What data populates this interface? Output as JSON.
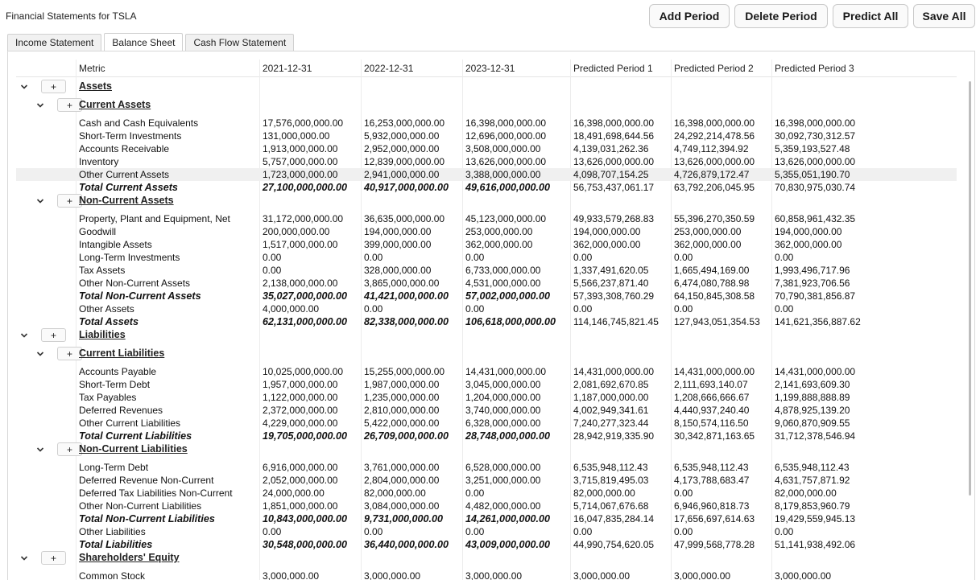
{
  "window": {
    "title": "Financial Statements for TSLA"
  },
  "toolbar": {
    "add_period": "Add Period",
    "delete_period": "Delete Period",
    "predict_all": "Predict All",
    "save_all": "Save All"
  },
  "tabs": [
    "Income Statement",
    "Balance Sheet",
    "Cash Flow Statement"
  ],
  "active_tab": "Balance Sheet",
  "columns": [
    "Metric",
    "2021-12-31",
    "2022-12-31",
    "2023-12-31",
    "Predicted Period 1",
    "Predicted Period 2",
    "Predicted Period 3"
  ],
  "plus_label": "+",
  "rows": [
    {
      "kind": "group",
      "level": 0,
      "label": "Assets"
    },
    {
      "kind": "group",
      "level": 1,
      "label": "Current Assets"
    },
    {
      "kind": "item",
      "label": "Cash and Cash Equivalents",
      "values": [
        "17,576,000,000.00",
        "16,253,000,000.00",
        "16,398,000,000.00",
        "16,398,000,000.00",
        "16,398,000,000.00",
        "16,398,000,000.00"
      ]
    },
    {
      "kind": "item",
      "label": "Short-Term Investments",
      "values": [
        "131,000,000.00",
        "5,932,000,000.00",
        "12,696,000,000.00",
        "18,491,698,644.56",
        "24,292,214,478.56",
        "30,092,730,312.57"
      ]
    },
    {
      "kind": "item",
      "label": "Accounts Receivable",
      "values": [
        "1,913,000,000.00",
        "2,952,000,000.00",
        "3,508,000,000.00",
        "4,139,031,262.36",
        "4,749,112,394.92",
        "5,359,193,527.48"
      ]
    },
    {
      "kind": "item",
      "label": "Inventory",
      "values": [
        "5,757,000,000.00",
        "12,839,000,000.00",
        "13,626,000,000.00",
        "13,626,000,000.00",
        "13,626,000,000.00",
        "13,626,000,000.00"
      ]
    },
    {
      "kind": "item",
      "label": "Other Current Assets",
      "highlight": true,
      "values": [
        "1,723,000,000.00",
        "2,941,000,000.00",
        "3,388,000,000.00",
        "4,098,707,154.25",
        "4,726,879,172.47",
        "5,355,051,190.70"
      ]
    },
    {
      "kind": "total",
      "label": "Total Current Assets",
      "values": [
        "27,100,000,000.00",
        "40,917,000,000.00",
        "49,616,000,000.00",
        "56,753,437,061.17",
        "63,792,206,045.95",
        "70,830,975,030.74"
      ]
    },
    {
      "kind": "group",
      "level": 1,
      "label": "Non-Current Assets"
    },
    {
      "kind": "item",
      "label": "Property, Plant and Equipment, Net",
      "values": [
        "31,172,000,000.00",
        "36,635,000,000.00",
        "45,123,000,000.00",
        "49,933,579,268.83",
        "55,396,270,350.59",
        "60,858,961,432.35"
      ]
    },
    {
      "kind": "item",
      "label": "Goodwill",
      "values": [
        "200,000,000.00",
        "194,000,000.00",
        "253,000,000.00",
        "194,000,000.00",
        "253,000,000.00",
        "194,000,000.00"
      ]
    },
    {
      "kind": "item",
      "label": "Intangible Assets",
      "values": [
        "1,517,000,000.00",
        "399,000,000.00",
        "362,000,000.00",
        "362,000,000.00",
        "362,000,000.00",
        "362,000,000.00"
      ]
    },
    {
      "kind": "item",
      "label": "Long-Term Investments",
      "values": [
        "0.00",
        "0.00",
        "0.00",
        "0.00",
        "0.00",
        "0.00"
      ]
    },
    {
      "kind": "item",
      "label": "Tax Assets",
      "values": [
        "0.00",
        "328,000,000.00",
        "6,733,000,000.00",
        "1,337,491,620.05",
        "1,665,494,169.00",
        "1,993,496,717.96"
      ]
    },
    {
      "kind": "item",
      "label": "Other Non-Current Assets",
      "values": [
        "2,138,000,000.00",
        "3,865,000,000.00",
        "4,531,000,000.00",
        "5,566,237,871.40",
        "6,474,080,788.98",
        "7,381,923,706.56"
      ]
    },
    {
      "kind": "total",
      "label": "Total Non-Current Assets",
      "values": [
        "35,027,000,000.00",
        "41,421,000,000.00",
        "57,002,000,000.00",
        "57,393,308,760.29",
        "64,150,845,308.58",
        "70,790,381,856.87"
      ]
    },
    {
      "kind": "item",
      "label": "Other Assets",
      "values": [
        "4,000,000.00",
        "0.00",
        "0.00",
        "0.00",
        "0.00",
        "0.00"
      ]
    },
    {
      "kind": "total",
      "label": "Total Assets",
      "values": [
        "62,131,000,000.00",
        "82,338,000,000.00",
        "106,618,000,000.00",
        "114,146,745,821.45",
        "127,943,051,354.53",
        "141,621,356,887.62"
      ]
    },
    {
      "kind": "group",
      "level": 0,
      "label": "Liabilities"
    },
    {
      "kind": "group",
      "level": 1,
      "label": "Current Liabilities"
    },
    {
      "kind": "item",
      "label": "Accounts Payable",
      "values": [
        "10,025,000,000.00",
        "15,255,000,000.00",
        "14,431,000,000.00",
        "14,431,000,000.00",
        "14,431,000,000.00",
        "14,431,000,000.00"
      ]
    },
    {
      "kind": "item",
      "label": "Short-Term Debt",
      "values": [
        "1,957,000,000.00",
        "1,987,000,000.00",
        "3,045,000,000.00",
        "2,081,692,670.85",
        "2,111,693,140.07",
        "2,141,693,609.30"
      ]
    },
    {
      "kind": "item",
      "label": "Tax Payables",
      "values": [
        "1,122,000,000.00",
        "1,235,000,000.00",
        "1,204,000,000.00",
        "1,187,000,000.00",
        "1,208,666,666.67",
        "1,199,888,888.89"
      ]
    },
    {
      "kind": "item",
      "label": "Deferred Revenues",
      "values": [
        "2,372,000,000.00",
        "2,810,000,000.00",
        "3,740,000,000.00",
        "4,002,949,341.61",
        "4,440,937,240.40",
        "4,878,925,139.20"
      ]
    },
    {
      "kind": "item",
      "label": "Other Current Liabilities",
      "values": [
        "4,229,000,000.00",
        "5,422,000,000.00",
        "6,328,000,000.00",
        "7,240,277,323.44",
        "8,150,574,116.50",
        "9,060,870,909.55"
      ]
    },
    {
      "kind": "total",
      "label": "Total Current Liabilities",
      "values": [
        "19,705,000,000.00",
        "26,709,000,000.00",
        "28,748,000,000.00",
        "28,942,919,335.90",
        "30,342,871,163.65",
        "31,712,378,546.94"
      ]
    },
    {
      "kind": "group",
      "level": 1,
      "label": "Non-Current Liabilities"
    },
    {
      "kind": "item",
      "label": "Long-Term Debt",
      "values": [
        "6,916,000,000.00",
        "3,761,000,000.00",
        "6,528,000,000.00",
        "6,535,948,112.43",
        "6,535,948,112.43",
        "6,535,948,112.43"
      ]
    },
    {
      "kind": "item",
      "label": "Deferred Revenue Non-Current",
      "values": [
        "2,052,000,000.00",
        "2,804,000,000.00",
        "3,251,000,000.00",
        "3,715,819,495.03",
        "4,173,788,683.47",
        "4,631,757,871.92"
      ]
    },
    {
      "kind": "item",
      "label": "Deferred Tax Liabilities Non-Current",
      "values": [
        "24,000,000.00",
        "82,000,000.00",
        "0.00",
        "82,000,000.00",
        "0.00",
        "82,000,000.00"
      ]
    },
    {
      "kind": "item",
      "label": "Other Non-Current Liabilities",
      "values": [
        "1,851,000,000.00",
        "3,084,000,000.00",
        "4,482,000,000.00",
        "5,714,067,676.68",
        "6,946,960,818.73",
        "8,179,853,960.79"
      ]
    },
    {
      "kind": "total",
      "label": "Total Non-Current Liabilities",
      "values": [
        "10,843,000,000.00",
        "9,731,000,000.00",
        "14,261,000,000.00",
        "16,047,835,284.14",
        "17,656,697,614.63",
        "19,429,559,945.13"
      ]
    },
    {
      "kind": "item",
      "label": "Other Liabilities",
      "values": [
        "0.00",
        "0.00",
        "0.00",
        "0.00",
        "0.00",
        "0.00"
      ]
    },
    {
      "kind": "total",
      "label": "Total Liabilities",
      "values": [
        "30,548,000,000.00",
        "36,440,000,000.00",
        "43,009,000,000.00",
        "44,990,754,620.05",
        "47,999,568,778.28",
        "51,141,938,492.06"
      ]
    },
    {
      "kind": "group",
      "level": 0,
      "label": "Shareholders' Equity"
    },
    {
      "kind": "item",
      "label": "Common Stock",
      "values": [
        "3,000,000.00",
        "3,000,000.00",
        "3,000,000.00",
        "3,000,000.00",
        "3,000,000.00",
        "3,000,000.00"
      ]
    }
  ]
}
